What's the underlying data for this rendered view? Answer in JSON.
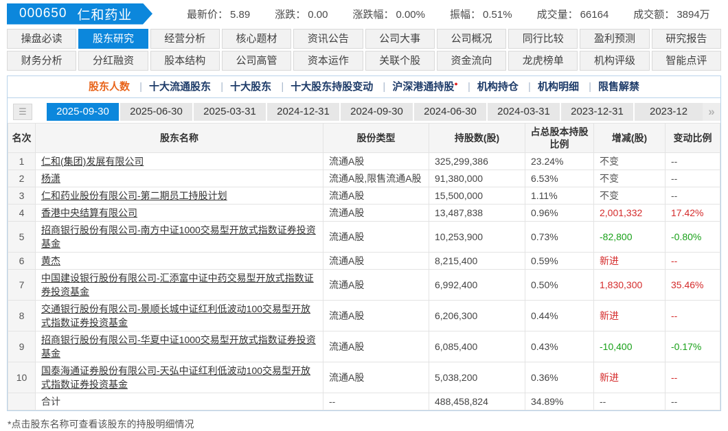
{
  "header": {
    "code": "000650",
    "name": "仁和药业",
    "quote": [
      {
        "label": "最新价：",
        "value": "5.89"
      },
      {
        "label": "涨跌：",
        "value": "0.00"
      },
      {
        "label": "涨跌幅：",
        "value": "0.00%"
      },
      {
        "label": "振幅：",
        "value": "0.51%"
      },
      {
        "label": "成交量：",
        "value": "66164"
      },
      {
        "label": "成交额：",
        "value": "3894万"
      }
    ]
  },
  "nav": {
    "row1": [
      {
        "label": "操盘必读"
      },
      {
        "label": "股东研究",
        "state": "active"
      },
      {
        "label": "经营分析"
      },
      {
        "label": "核心题材"
      },
      {
        "label": "资讯公告"
      },
      {
        "label": "公司大事"
      },
      {
        "label": "公司概况"
      },
      {
        "label": "同行比较"
      },
      {
        "label": "盈利预测"
      },
      {
        "label": "研究报告"
      }
    ],
    "row2": [
      {
        "label": "财务分析"
      },
      {
        "label": "分红融资"
      },
      {
        "label": "股本结构"
      },
      {
        "label": "公司高管"
      },
      {
        "label": "资本运作"
      },
      {
        "label": "关联个股"
      },
      {
        "label": "资金流向"
      },
      {
        "label": "龙虎榜单"
      },
      {
        "label": "机构评级"
      },
      {
        "label": "智能点评"
      }
    ]
  },
  "subnav": {
    "items": [
      {
        "label": "股东人数",
        "state": "active"
      },
      {
        "label": "十大流通股东"
      },
      {
        "label": "十大股东"
      },
      {
        "label": "十大股东持股变动"
      },
      {
        "label": "沪深港通持股",
        "badge": "●"
      },
      {
        "label": "机构持仓"
      },
      {
        "label": "机构明细"
      },
      {
        "label": "限售解禁"
      }
    ]
  },
  "datebar": {
    "list_icon": "☰",
    "more_icon": "»",
    "tabs": [
      {
        "label": "2025-09-30",
        "state": "active"
      },
      {
        "label": "2025-06-30"
      },
      {
        "label": "2025-03-31"
      },
      {
        "label": "2024-12-31"
      },
      {
        "label": "2024-09-30"
      },
      {
        "label": "2024-06-30"
      },
      {
        "label": "2024-03-31"
      },
      {
        "label": "2023-12-31"
      },
      {
        "label": "2023-12",
        "state": "clipped"
      }
    ]
  },
  "table": {
    "headers": {
      "rank": "名次",
      "name": "股东名称",
      "type": "股份类型",
      "shares": "持股数(股)",
      "ratio": "占总股本持股比例",
      "change": "增减(股)",
      "change_ratio": "变动比例"
    },
    "rows": [
      {
        "rank": "1",
        "name": "仁和(集团)发展有限公司",
        "type": "流通A股",
        "shares": "325,299,386",
        "ratio": "23.24%",
        "change": "不变",
        "change_cls": "gray",
        "change_ratio": "--",
        "ratio_cls": "gray"
      },
      {
        "rank": "2",
        "name": "杨潇",
        "type": "流通A股,限售流通A股",
        "shares": "91,380,000",
        "ratio": "6.53%",
        "change": "不变",
        "change_cls": "gray",
        "change_ratio": "--",
        "ratio_cls": "gray"
      },
      {
        "rank": "3",
        "name": "仁和药业股份有限公司-第二期员工持股计划",
        "type": "流通A股",
        "shares": "15,500,000",
        "ratio": "1.11%",
        "change": "不变",
        "change_cls": "gray",
        "change_ratio": "--",
        "ratio_cls": "gray"
      },
      {
        "rank": "4",
        "name": "香港中央结算有限公司",
        "type": "流通A股",
        "shares": "13,487,838",
        "ratio": "0.96%",
        "change": "2,001,332",
        "change_cls": "red",
        "change_ratio": "17.42%",
        "ratio_cls": "red"
      },
      {
        "rank": "5",
        "name": "招商银行股份有限公司-南方中证1000交易型开放式指数证券投资基金",
        "type": "流通A股",
        "shares": "10,253,900",
        "ratio": "0.73%",
        "change": "-82,800",
        "change_cls": "green",
        "change_ratio": "-0.80%",
        "ratio_cls": "green"
      },
      {
        "rank": "6",
        "name": "黄杰",
        "type": "流通A股",
        "shares": "8,215,400",
        "ratio": "0.59%",
        "change": "新进",
        "change_cls": "red",
        "change_ratio": "--",
        "ratio_cls": "red"
      },
      {
        "rank": "7",
        "name": "中国建设银行股份有限公司-汇添富中证中药交易型开放式指数证券投资基金",
        "type": "流通A股",
        "shares": "6,992,400",
        "ratio": "0.50%",
        "change": "1,830,300",
        "change_cls": "red",
        "change_ratio": "35.46%",
        "ratio_cls": "red"
      },
      {
        "rank": "8",
        "name": "交通银行股份有限公司-景顺长城中证红利低波动100交易型开放式指数证券投资基金",
        "type": "流通A股",
        "shares": "6,206,300",
        "ratio": "0.44%",
        "change": "新进",
        "change_cls": "red",
        "change_ratio": "--",
        "ratio_cls": "red"
      },
      {
        "rank": "9",
        "name": "招商银行股份有限公司-华夏中证1000交易型开放式指数证券投资基金",
        "type": "流通A股",
        "shares": "6,085,400",
        "ratio": "0.43%",
        "change": "-10,400",
        "change_cls": "green",
        "change_ratio": "-0.17%",
        "ratio_cls": "green"
      },
      {
        "rank": "10",
        "name": "国泰海通证券股份有限公司-天弘中证红利低波动100交易型开放式指数证券投资基金",
        "type": "流通A股",
        "shares": "5,038,200",
        "ratio": "0.36%",
        "change": "新进",
        "change_cls": "red",
        "change_ratio": "--",
        "ratio_cls": "red"
      }
    ],
    "total": {
      "name": "合计",
      "type": "--",
      "shares": "488,458,824",
      "ratio": "34.89%",
      "change": "--",
      "change_ratio": "--"
    }
  },
  "footer": {
    "note": "*点击股东名称可查看该股东的持股明细情况"
  },
  "colors": {
    "accent_blue": "#0c87dc",
    "subnav_navy": "#1c3a68",
    "active_orange": "#e8641b",
    "up_red": "#d42a2a",
    "down_green": "#18a018",
    "badge_red": "#e02020"
  }
}
